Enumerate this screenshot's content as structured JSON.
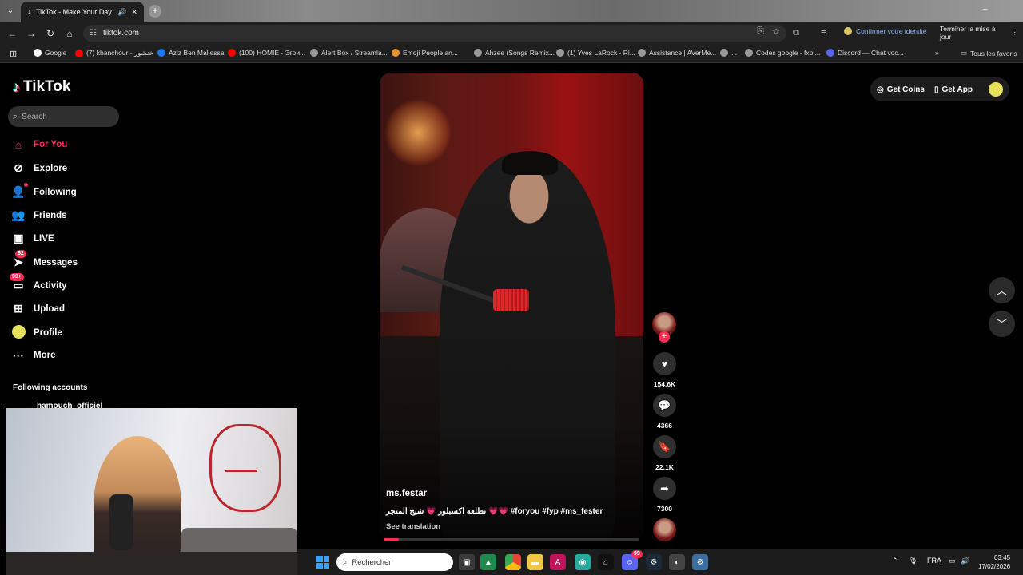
{
  "browser": {
    "tab_title": "TikTok - Make Your Day",
    "url": "tiktok.com",
    "confirm_identity": "Confirmer votre identité",
    "update_label": "Terminer la mise à jour",
    "bookmarks": [
      "Google",
      "(7) khanchour - خنشور",
      "Aziz Ben Mallessa",
      "(100) HOMIE - Эгои...",
      "Alert Box / Streamla...",
      "Emoji People an...",
      "Ahzee (Songs Remix...",
      "(1) Yves LaRock - Ri...",
      "Assistance | AVerMe...",
      "...",
      "Codes google - fxpi...",
      "Discord — Chat voc..."
    ],
    "all_bookmarks": "Tous les favoris"
  },
  "sidebar": {
    "logo": "TikTok",
    "search_placeholder": "Search",
    "items": [
      {
        "label": "For You",
        "icon": "home-icon"
      },
      {
        "label": "Explore",
        "icon": "compass-icon"
      },
      {
        "label": "Following",
        "icon": "following-icon"
      },
      {
        "label": "Friends",
        "icon": "friends-icon"
      },
      {
        "label": "LIVE",
        "icon": "live-icon"
      },
      {
        "label": "Messages",
        "icon": "messages-icon",
        "badge": "62"
      },
      {
        "label": "Activity",
        "icon": "activity-icon",
        "badge": "99+"
      },
      {
        "label": "Upload",
        "icon": "upload-icon"
      },
      {
        "label": "Profile",
        "icon": "profile-icon"
      },
      {
        "label": "More",
        "icon": "more-icon"
      }
    ],
    "following_accounts_title": "Following accounts",
    "following_account": "hamouch_officiel"
  },
  "video": {
    "author": "ms.festar",
    "caption": "نطلعه اكسبلور 💗 شيخ المتجر 💗💗 #foryou #fyp #ms_fester",
    "see_translation": "See translation",
    "progress": 0.06,
    "likes": "154.6K",
    "comments": "4366",
    "saves": "22.1K",
    "shares": "7300"
  },
  "header": {
    "get_coins": "Get Coins",
    "get_app": "Get App"
  },
  "taskbar": {
    "search_placeholder": "Rechercher",
    "language": "FRA",
    "time": "03:45",
    "date": "17/02/2026",
    "discord_badge": "99"
  },
  "colors": {
    "accent": "#fe2c55",
    "link": "#8ab4f8"
  }
}
